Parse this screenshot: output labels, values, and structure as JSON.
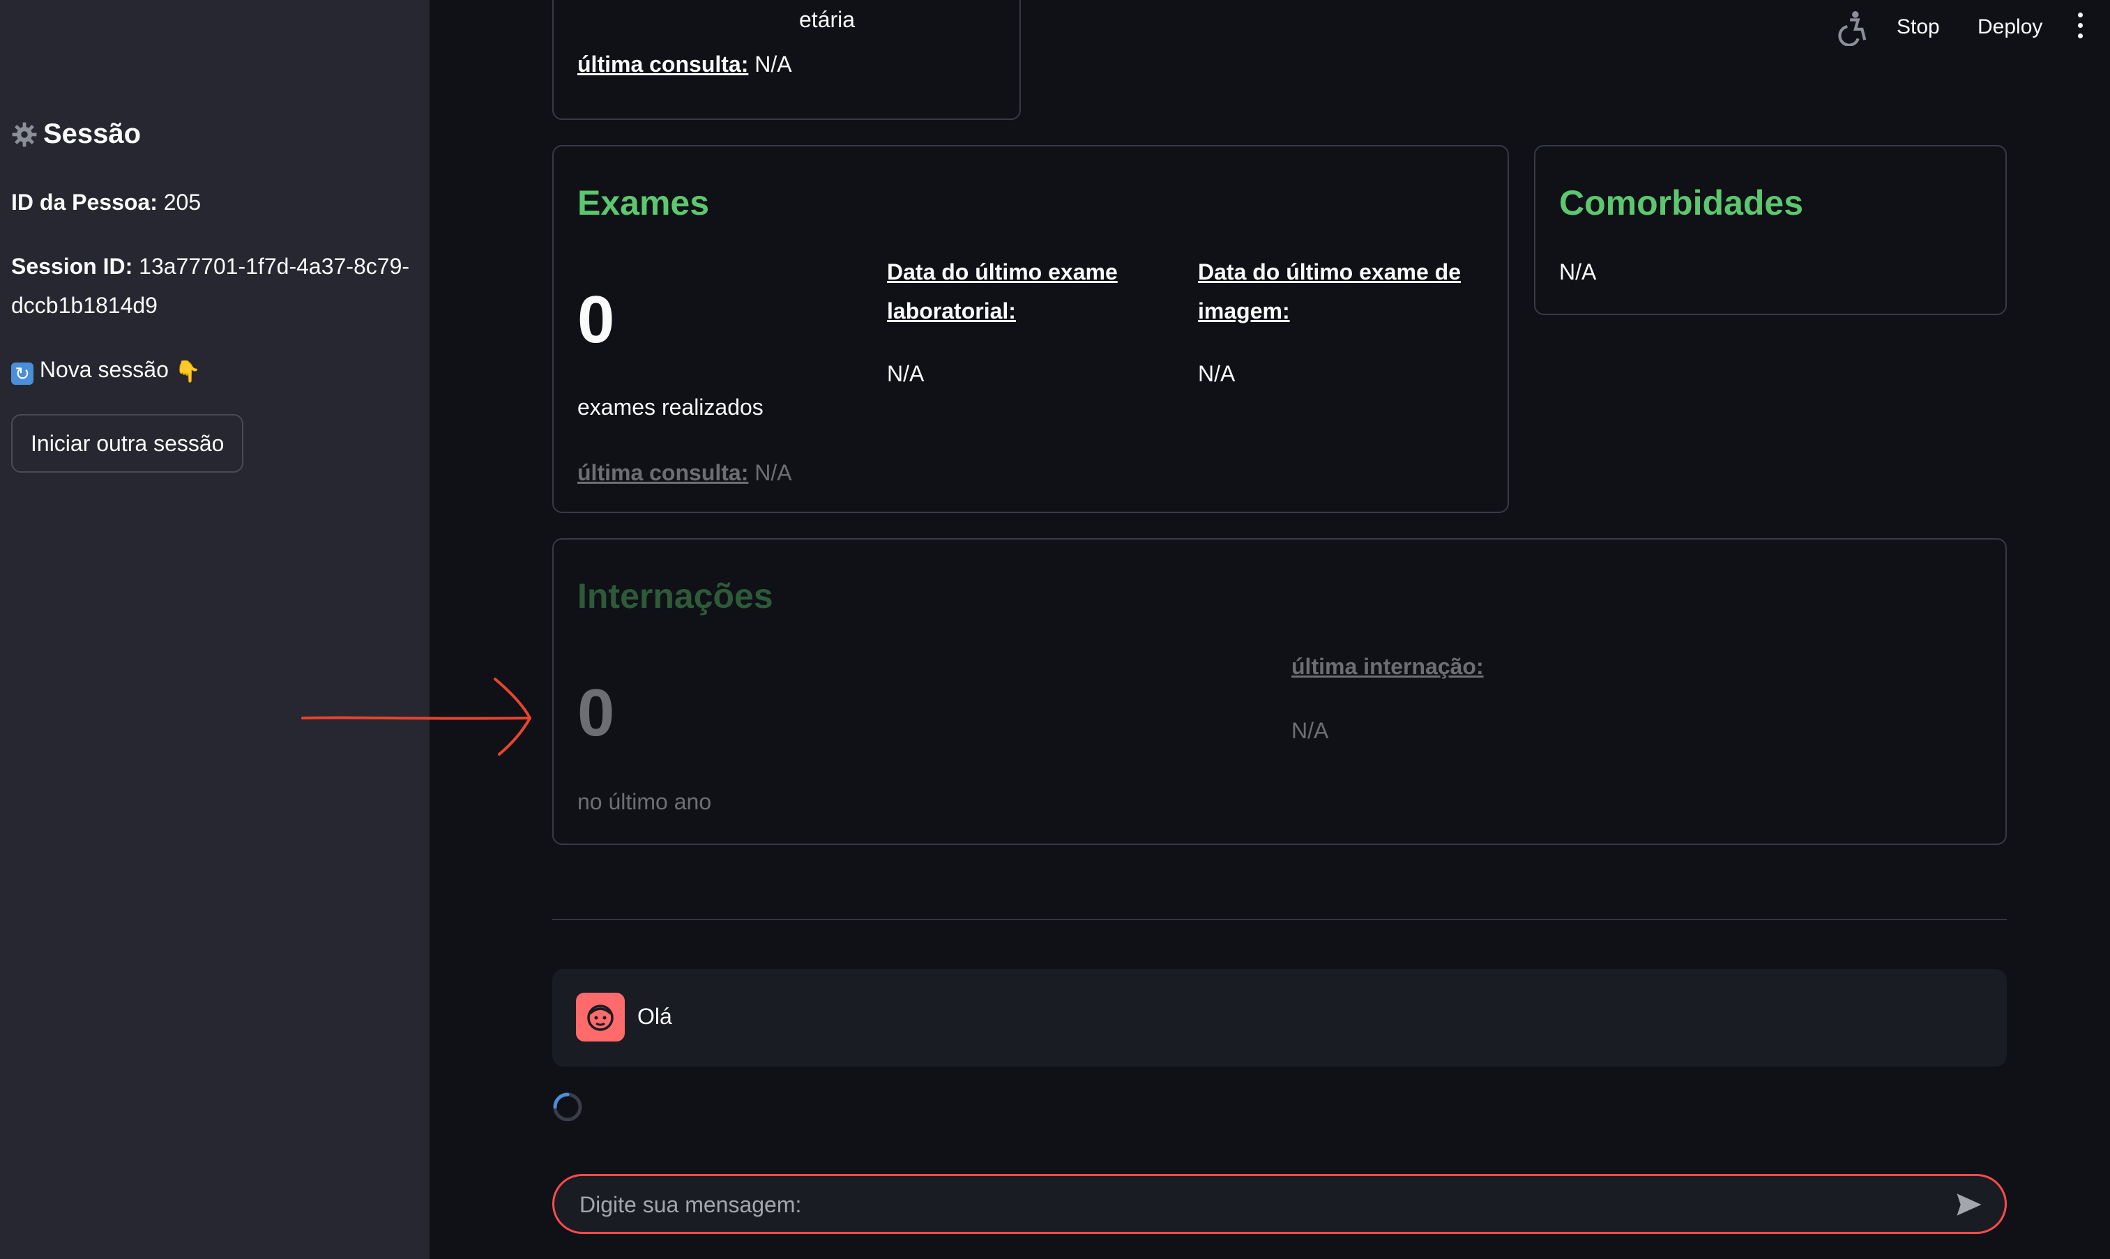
{
  "sidebar": {
    "title": "Sessão",
    "person_id_label": "ID da Pessoa:",
    "person_id_value": "205",
    "session_id_label": "Session ID:",
    "session_id_value_line1": "13a77701-1f7d-4a37-8c79-",
    "session_id_value_line2": "dccb1b1814d9",
    "new_session_label": "Nova sessão",
    "new_session_emoji": "👇",
    "start_button_label": "Iniciar outra sessão"
  },
  "topbar": {
    "stop_label": "Stop",
    "deploy_label": "Deploy"
  },
  "top_card": {
    "partial_text": "etária",
    "last_consult_label": "última consulta:",
    "last_consult_value": "N/A"
  },
  "exams": {
    "title": "Exames",
    "count": "0",
    "count_caption": "exames realizados",
    "lab_label_line1": "Data do último exame",
    "lab_label_line2": "laboratorial:",
    "lab_value": "N/A",
    "image_label_line1": "Data do último exame de",
    "image_label_line2": "imagem:",
    "image_value": "N/A",
    "last_consult_label": "última consulta:",
    "last_consult_value": "N/A"
  },
  "comorbidities": {
    "title": "Comorbidades",
    "value": "N/A"
  },
  "hospitalizations": {
    "title": "Internações",
    "count": "0",
    "count_caption": "no último ano",
    "last_label": "última internação:",
    "last_value": "N/A"
  },
  "chat": {
    "message": "Olá",
    "input_placeholder": "Digite sua mensagem:"
  },
  "colors": {
    "accent_green": "#5cc76f",
    "accent_red": "#ff4b4b",
    "annotation_arrow": "#e8442e"
  }
}
